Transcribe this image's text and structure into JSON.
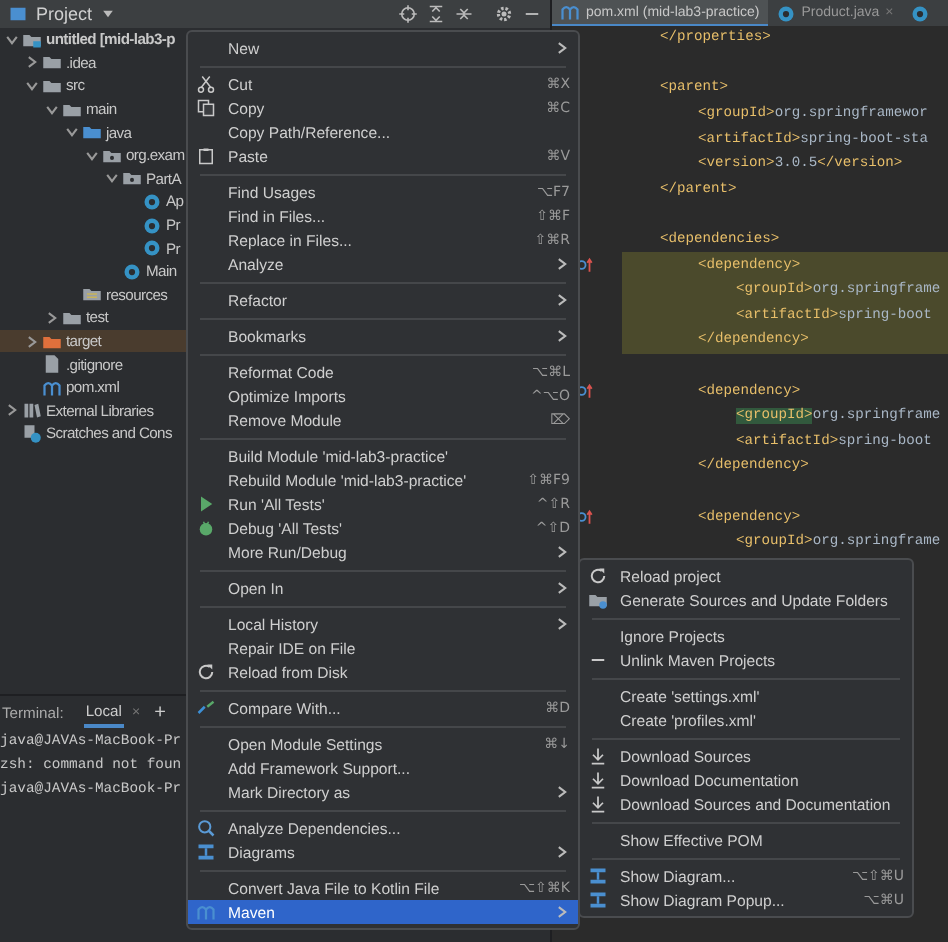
{
  "toolbar": {
    "title": "Project"
  },
  "tabs": [
    {
      "label": "pom.xml (mid-lab3-practice)",
      "kind": "maven",
      "selected": true
    },
    {
      "label": "Product.java",
      "kind": "class",
      "close": "×",
      "selected": false
    },
    {
      "kind": "class",
      "selected": false
    }
  ],
  "tree": [
    {
      "label": "untitled [mid-lab3-p",
      "kind": "module",
      "expanded": true,
      "children": [
        {
          "label": ".idea",
          "kind": "folder",
          "expanded": false
        },
        {
          "label": "src",
          "kind": "folder",
          "expanded": true,
          "children": [
            {
              "label": "main",
              "kind": "folder",
              "expanded": true,
              "children": [
                {
                  "label": "java",
                  "kind": "source-folder",
                  "expanded": true,
                  "children": [
                    {
                      "label": "org.exam",
                      "kind": "package",
                      "expanded": true,
                      "children": [
                        {
                          "label": "PartA",
                          "kind": "package",
                          "expanded": true,
                          "children": [
                            {
                              "label": "Ap",
                              "kind": "class"
                            },
                            {
                              "label": "Pr",
                              "kind": "class"
                            },
                            {
                              "label": "Pr",
                              "kind": "class"
                            }
                          ]
                        },
                        {
                          "label": "Main",
                          "kind": "class"
                        }
                      ]
                    }
                  ]
                },
                {
                  "label": "resources",
                  "kind": "resources"
                }
              ]
            },
            {
              "label": "test",
              "kind": "folder",
              "expanded": false
            }
          ]
        },
        {
          "label": "target",
          "kind": "excluded-folder",
          "expanded": false
        },
        {
          "label": ".gitignore",
          "kind": "file"
        },
        {
          "label": "pom.xml",
          "kind": "maven"
        }
      ]
    },
    {
      "label": "External Libraries",
      "kind": "library",
      "expanded": false
    },
    {
      "label": "Scratches and Cons",
      "kind": "scratches"
    }
  ],
  "terminal": {
    "title": "Terminal:",
    "tabs": [
      {
        "label": "Local",
        "close": "×",
        "selected": true
      }
    ],
    "add": "+",
    "lines": [
      "java@JAVAs-MacBook-Pr",
      "zsh: command not foun",
      "java@JAVAs-MacBook-Pr"
    ]
  },
  "code": [
    {
      "kind": "line",
      "parts": [
        {
          "kind": "tag",
          "text": "</properties>"
        }
      ]
    },
    {
      "kind": "blank"
    },
    {
      "kind": "line",
      "parts": [
        {
          "kind": "tag",
          "text": "<parent>"
        }
      ],
      "children": [
        {
          "kind": "line",
          "parts": [
            {
              "kind": "tag",
              "text": "<groupId>"
            },
            {
              "kind": "text",
              "text": "org.springframewor"
            }
          ]
        },
        {
          "kind": "line",
          "parts": [
            {
              "kind": "tag",
              "text": "<artifactId>"
            },
            {
              "kind": "text",
              "text": "spring-boot-sta"
            }
          ]
        },
        {
          "kind": "line",
          "parts": [
            {
              "kind": "tag",
              "text": "<version>"
            },
            {
              "kind": "text",
              "text": "3.0.5"
            },
            {
              "kind": "tag",
              "text": "</version>"
            }
          ]
        }
      ]
    },
    {
      "kind": "line",
      "parts": [
        {
          "kind": "tag",
          "text": "</parent>"
        }
      ]
    },
    {
      "kind": "blank"
    },
    {
      "kind": "line",
      "parts": [
        {
          "kind": "tag",
          "text": "<dependencies>"
        }
      ],
      "children": [
        {
          "kind": "line",
          "marker": true,
          "highlighted": true,
          "parts": [
            {
              "kind": "tag",
              "text": "<dependency>"
            }
          ],
          "children": [
            {
              "kind": "line",
              "highlighted": true,
              "parts": [
                {
                  "kind": "tag",
                  "text": "<groupId>"
                },
                {
                  "kind": "text",
                  "text": "org.springframe"
                }
              ]
            },
            {
              "kind": "line",
              "highlighted": true,
              "parts": [
                {
                  "kind": "tag",
                  "text": "<artifactId>"
                },
                {
                  "kind": "text",
                  "text": "spring-boot"
                }
              ]
            }
          ]
        },
        {
          "kind": "line",
          "highlighted": true,
          "parts": [
            {
              "kind": "tag",
              "text": "</dependency>"
            }
          ]
        },
        {
          "kind": "blank"
        },
        {
          "kind": "line",
          "marker": true,
          "parts": [
            {
              "kind": "tag",
              "text": "<dependency>"
            }
          ],
          "children": [
            {
              "kind": "line",
              "parts": [
                {
                  "kind": "match",
                  "text": "<groupId>"
                },
                {
                  "kind": "text",
                  "text": "org.springframe"
                }
              ]
            },
            {
              "kind": "line",
              "parts": [
                {
                  "kind": "tag",
                  "text": "<artifactId>"
                },
                {
                  "kind": "text",
                  "text": "spring-boot"
                }
              ]
            }
          ]
        },
        {
          "kind": "line",
          "parts": [
            {
              "kind": "tag",
              "text": "</dependency>"
            }
          ]
        },
        {
          "kind": "blank"
        },
        {
          "kind": "line",
          "marker": true,
          "parts": [
            {
              "kind": "tag",
              "text": "<dependency>"
            }
          ],
          "children": [
            {
              "kind": "line",
              "parts": [
                {
                  "kind": "tag",
                  "text": "<groupId>"
                },
                {
                  "kind": "text",
                  "text": "org.springframe"
                }
              ]
            }
          ]
        }
      ]
    }
  ],
  "menu": [
    {
      "kind": "item",
      "label": "New",
      "submenu": true,
      "selected": false
    },
    {
      "kind": "separator"
    },
    {
      "kind": "scissors",
      "label": "Cut",
      "shortcut": "⌘X",
      "selected": false
    },
    {
      "kind": "copy",
      "label": "Copy",
      "shortcut": "⌘C",
      "selected": false
    },
    {
      "kind": "item",
      "label": "Copy Path/Reference...",
      "selected": false
    },
    {
      "kind": "paste",
      "label": "Paste",
      "shortcut": "⌘V",
      "selected": false
    },
    {
      "kind": "separator"
    },
    {
      "kind": "item",
      "label": "Find Usages",
      "shortcut": "⌥F7",
      "selected": false
    },
    {
      "kind": "item",
      "label": "Find in Files...",
      "shortcut": "⇧⌘F",
      "selected": false
    },
    {
      "kind": "item",
      "label": "Replace in Files...",
      "shortcut": "⇧⌘R",
      "selected": false
    },
    {
      "kind": "item",
      "label": "Analyze",
      "submenu": true,
      "selected": false
    },
    {
      "kind": "separator"
    },
    {
      "kind": "item",
      "label": "Refactor",
      "submenu": true,
      "selected": false
    },
    {
      "kind": "separator"
    },
    {
      "kind": "item",
      "label": "Bookmarks",
      "submenu": true,
      "selected": false
    },
    {
      "kind": "separator"
    },
    {
      "kind": "item",
      "label": "Reformat Code",
      "shortcut": "⌥⌘L",
      "selected": false
    },
    {
      "kind": "item",
      "label": "Optimize Imports",
      "shortcut": "^⌥O",
      "selected": false
    },
    {
      "kind": "item",
      "label": "Remove Module",
      "shortcut": "⌦",
      "selected": false
    },
    {
      "kind": "separator"
    },
    {
      "kind": "item",
      "label": "Build Module 'mid-lab3-practice'",
      "selected": false
    },
    {
      "kind": "item",
      "label": "Rebuild Module 'mid-lab3-practice'",
      "shortcut": "⇧⌘F9",
      "selected": false
    },
    {
      "kind": "play",
      "label": "Run 'All Tests'",
      "shortcut": "^⇧R",
      "selected": false
    },
    {
      "kind": "bug",
      "label": "Debug 'All Tests'",
      "shortcut": "^⇧D",
      "selected": false
    },
    {
      "kind": "item",
      "label": "More Run/Debug",
      "submenu": true,
      "selected": false
    },
    {
      "kind": "separator"
    },
    {
      "kind": "item",
      "label": "Open In",
      "submenu": true,
      "selected": false
    },
    {
      "kind": "separator"
    },
    {
      "kind": "item",
      "label": "Local History",
      "submenu": true,
      "selected": false
    },
    {
      "kind": "item",
      "label": "Repair IDE on File",
      "selected": false
    },
    {
      "kind": "reload",
      "label": "Reload from Disk",
      "selected": false
    },
    {
      "kind": "separator"
    },
    {
      "kind": "compare",
      "label": "Compare With...",
      "shortcut": "⌘D",
      "selected": false
    },
    {
      "kind": "separator"
    },
    {
      "kind": "item",
      "label": "Open Module Settings",
      "shortcut": "⌘↓",
      "selected": false
    },
    {
      "kind": "item",
      "label": "Add Framework Support...",
      "selected": false
    },
    {
      "kind": "item",
      "label": "Mark Directory as",
      "submenu": true,
      "selected": false
    },
    {
      "kind": "separator"
    },
    {
      "kind": "analyze",
      "label": "Analyze Dependencies...",
      "selected": false
    },
    {
      "kind": "diagram",
      "label": "Diagrams",
      "submenu": true,
      "selected": false
    },
    {
      "kind": "separator"
    },
    {
      "kind": "item",
      "label": "Convert Java File to Kotlin File",
      "shortcut": "⌥⇧⌘K",
      "selected": false
    },
    {
      "kind": "maven",
      "label": "Maven",
      "submenu": true,
      "selected": true
    }
  ],
  "submenu": [
    {
      "kind": "reload",
      "label": "Reload project",
      "selected": false
    },
    {
      "kind": "generate",
      "label": "Generate Sources and Update Folders",
      "selected": false
    },
    {
      "kind": "separator"
    },
    {
      "kind": "item",
      "label": "Ignore Projects",
      "selected": false
    },
    {
      "kind": "minus",
      "label": "Unlink Maven Projects",
      "selected": false
    },
    {
      "kind": "separator"
    },
    {
      "kind": "item",
      "label": "Create 'settings.xml'",
      "selected": false
    },
    {
      "kind": "item",
      "label": "Create 'profiles.xml'",
      "selected": false
    },
    {
      "kind": "separator"
    },
    {
      "kind": "download",
      "label": "Download Sources",
      "selected": false
    },
    {
      "kind": "download",
      "label": "Download Documentation",
      "selected": false
    },
    {
      "kind": "download",
      "label": "Download Sources and Documentation",
      "selected": false
    },
    {
      "kind": "separator"
    },
    {
      "kind": "item",
      "label": "Show Effective POM",
      "selected": false
    },
    {
      "kind": "separator"
    },
    {
      "kind": "diagram",
      "label": "Show Diagram...",
      "shortcut": "⌥⇧⌘U",
      "selected": false
    },
    {
      "kind": "diagram",
      "label": "Show Diagram Popup...",
      "shortcut": "⌥⌘U",
      "selected": false
    }
  ]
}
